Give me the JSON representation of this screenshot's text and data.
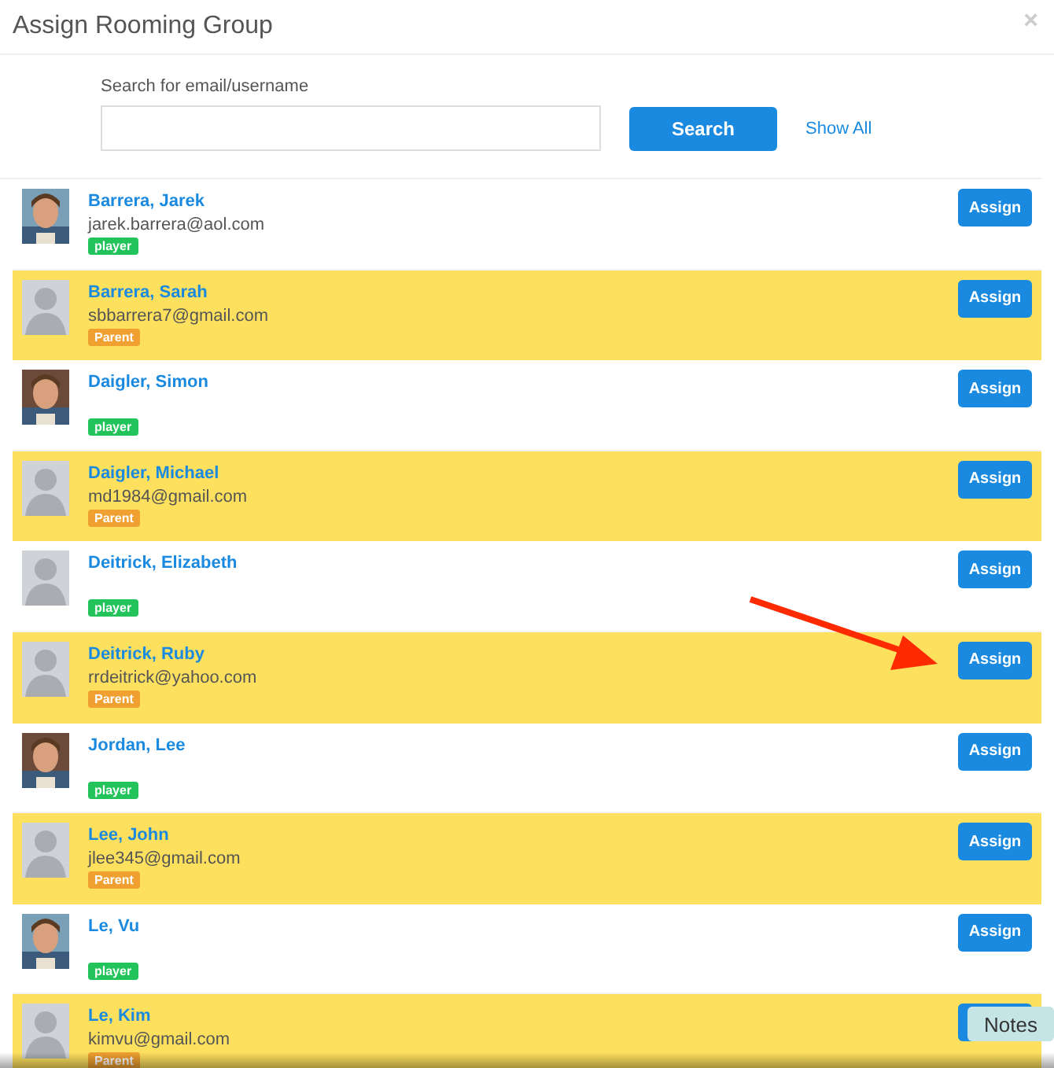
{
  "dialog": {
    "title": "Assign Rooming Group",
    "close": "×"
  },
  "search": {
    "label": "Search for email/username",
    "button": "Search",
    "show_all": "Show All"
  },
  "rows": [
    {
      "name": "Barrera, Jarek",
      "email": "jarek.barrera@aol.com",
      "badge": {
        "text": "player",
        "kind": "player"
      },
      "highlighted": false,
      "button": "Assign"
    },
    {
      "name": "Barrera, Sarah",
      "email": "sbbarrera7@gmail.com",
      "badge": {
        "text": "Parent",
        "kind": "parent"
      },
      "avatar": {
        "kind": "silhouette"
      },
      "highlighted": true,
      "button": "Assign"
    },
    {
      "name": "Daigler, Simon",
      "badge": {
        "text": "player",
        "kind": "player"
      },
      "highlighted": false,
      "button": "Assign"
    },
    {
      "name": "Daigler, Michael",
      "email": "md1984@gmail.com",
      "badge": {
        "text": "Parent",
        "kind": "parent"
      },
      "avatar": {
        "kind": "silhouette"
      },
      "highlighted": true,
      "button": "Assign"
    },
    {
      "name": "Deitrick, Elizabeth",
      "badge": {
        "text": "player",
        "kind": "player"
      },
      "avatar": {
        "kind": "silhouette"
      },
      "highlighted": false,
      "button": "Assign"
    },
    {
      "name": "Deitrick, Ruby",
      "email": "rrdeitrick@yahoo.com",
      "badge": {
        "text": "Parent",
        "kind": "parent"
      },
      "avatar": {
        "kind": "silhouette"
      },
      "highlighted": true,
      "button": "Assign"
    },
    {
      "name": "Jordan, Lee",
      "badge": {
        "text": "player",
        "kind": "player"
      },
      "highlighted": false,
      "button": "Assign"
    },
    {
      "name": "Lee, John",
      "email": "jlee345@gmail.com",
      "badge": {
        "text": "Parent",
        "kind": "parent"
      },
      "avatar": {
        "kind": "silhouette"
      },
      "highlighted": true,
      "button": "Assign"
    },
    {
      "name": "Le, Vu",
      "badge": {
        "text": "player",
        "kind": "player"
      },
      "highlighted": false,
      "button": "Assign"
    },
    {
      "name": "Le, Kim",
      "email": "kimvu@gmail.com",
      "badge": {
        "text": "Parent",
        "kind": "parent"
      },
      "avatar": {
        "kind": "silhouette"
      },
      "highlighted": true
    }
  ],
  "tooltip": {
    "text": "Notes"
  }
}
